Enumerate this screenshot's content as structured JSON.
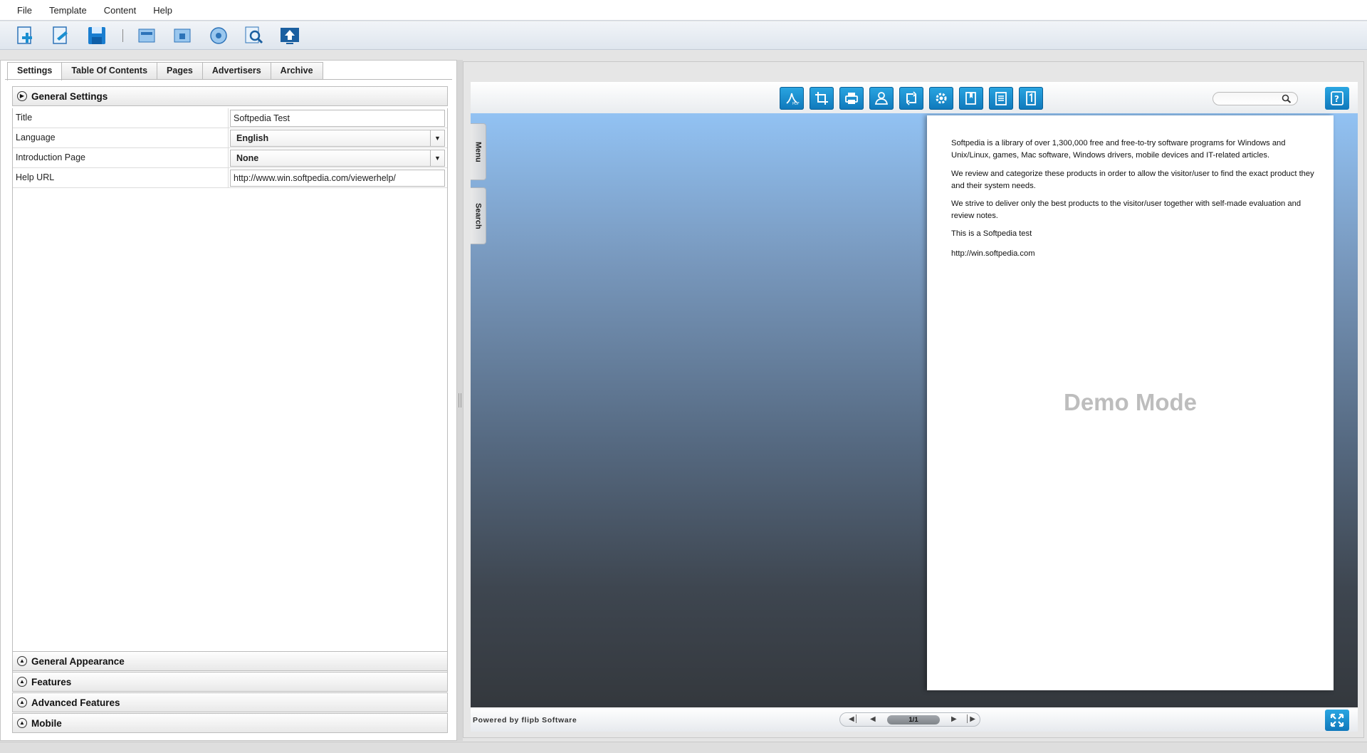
{
  "menu": {
    "items": [
      "File",
      "Template",
      "Content",
      "Help"
    ]
  },
  "toolbar": {
    "icons": [
      "new-project-icon",
      "edit-icon",
      "save-icon",
      "import-pages-icon",
      "import-file-icon",
      "publish-icon",
      "preview-icon",
      "upload-icon"
    ]
  },
  "tabs": [
    "Settings",
    "Table Of Contents",
    "Pages",
    "Advertisers",
    "Archive"
  ],
  "active_tab": "Settings",
  "general_settings": {
    "header": "General Settings",
    "rows": [
      {
        "label": "Title",
        "value": "Softpedia Test"
      },
      {
        "label": "Language",
        "value": "English"
      },
      {
        "label": "Introduction Page",
        "value": "None"
      },
      {
        "label": "Help URL",
        "value": "http://www.win.softpedia.com/viewerhelp/"
      }
    ]
  },
  "collapsed_sections": [
    "General Appearance",
    "Features",
    "Advanced Features",
    "Mobile"
  ],
  "viewer": {
    "toolbar_icons": [
      "pdf-icon",
      "crop-icon",
      "print-icon",
      "share-icon",
      "rotate-icon",
      "settings-icon",
      "bookmark-icon",
      "notes-icon",
      "single-page-icon"
    ],
    "side_tabs": [
      "Menu",
      "Search"
    ],
    "page_text": [
      "Softpedia is a library of over 1,300,000 free and free-to-try software programs for Windows and Unix/Linux, games, Mac software, Windows drivers, mobile devices and IT-related articles.",
      "We review and categorize these products in order to allow the visitor/user to find the exact product they and their system needs.",
      "We strive to deliver only the best products to the visitor/user together with self-made evaluation and review notes.",
      "This is a Softpedia test",
      "http://win.softpedia.com"
    ],
    "watermark": "Demo Mode",
    "powered_by": "Powered by flipb Software",
    "page_indicator": "1/1"
  },
  "colors": {
    "accent": "#1a8fd1",
    "stage_top": "#92c2f3",
    "stage_bottom": "#34383d"
  }
}
